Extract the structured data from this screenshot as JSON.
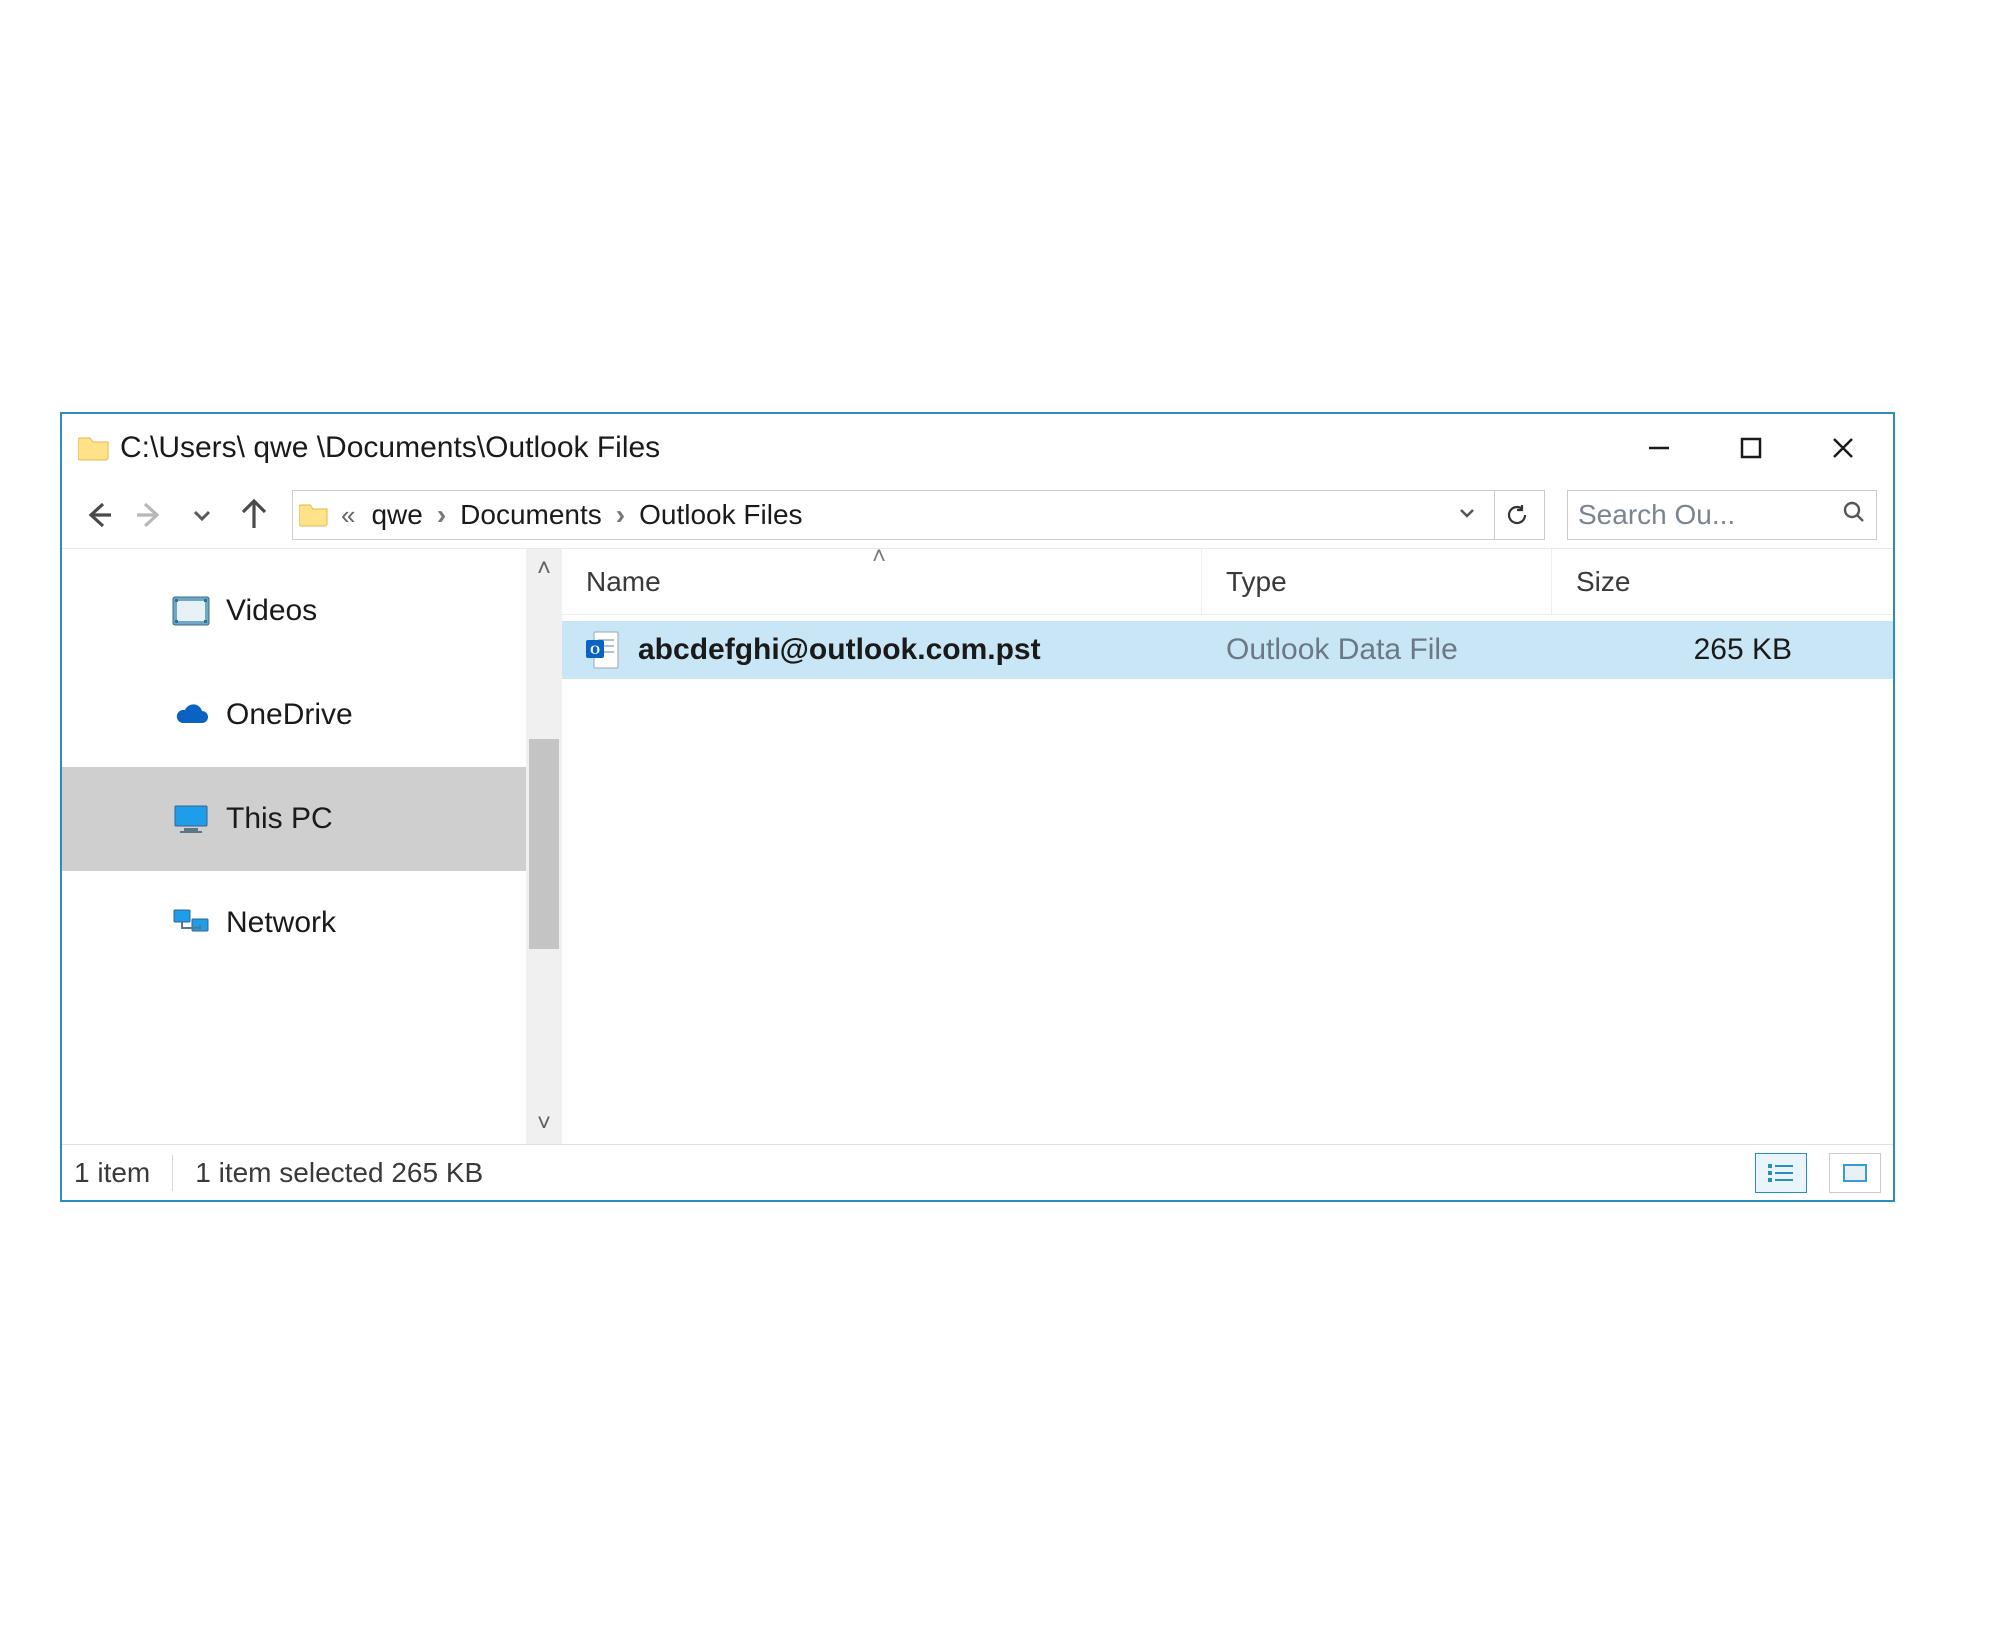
{
  "titlebar": {
    "path": "C:\\Users\\ qwe \\Documents\\Outlook Files"
  },
  "breadcrumb": {
    "overflow": "«",
    "items": [
      "qwe",
      "Documents",
      "Outlook Files"
    ]
  },
  "search": {
    "placeholder": "Search Ou..."
  },
  "sidebar": {
    "items": [
      {
        "label": "Videos"
      },
      {
        "label": "OneDrive"
      },
      {
        "label": "This PC"
      },
      {
        "label": "Network"
      }
    ]
  },
  "columns": {
    "name": "Name",
    "type": "Type",
    "size": "Size"
  },
  "files": [
    {
      "name": "abcdefghi@outlook.com.pst",
      "type": "Outlook Data File",
      "size": "265 KB"
    }
  ],
  "status": {
    "count": "1 item",
    "selection": "1 item selected  265 KB"
  }
}
